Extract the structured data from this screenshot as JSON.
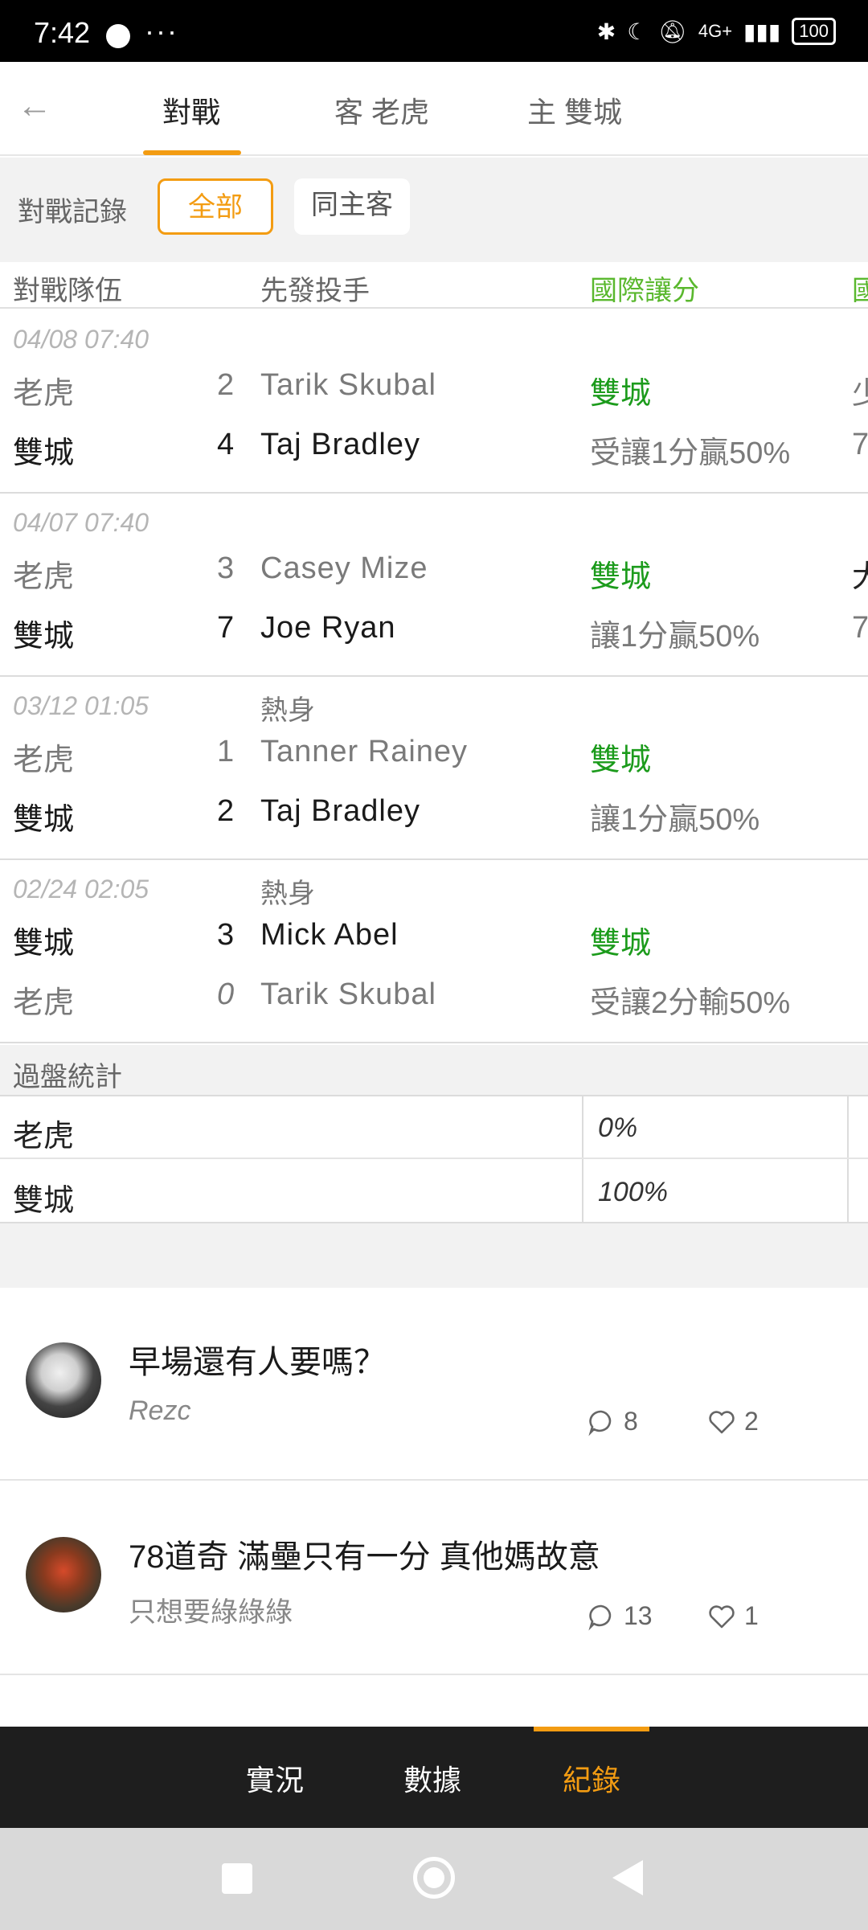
{
  "status_bar": {
    "time": "7:42",
    "more": "···",
    "network": "4G+",
    "battery": "100"
  },
  "nav": {
    "tabs": [
      {
        "label": "對戰"
      },
      {
        "label": "客 老虎"
      },
      {
        "label": "主 雙城"
      }
    ],
    "active_tab": 0
  },
  "filter": {
    "label": "對戰記錄",
    "chips": [
      {
        "label": "全部"
      },
      {
        "label": "同主客"
      }
    ],
    "selected": "全部"
  },
  "table_header": {
    "team": "對戰隊伍",
    "pitcher": "先發投手",
    "handicap": "國際讓分",
    "extra": "國"
  },
  "matches": [
    {
      "date": "04/08 07:40",
      "tag": "",
      "rows": [
        {
          "team": "老虎",
          "score": "2",
          "pitcher": "Tarik Skubal",
          "odds": "雙城",
          "extra": "少"
        },
        {
          "team": "雙城",
          "score": "4",
          "pitcher": "Taj Bradley",
          "odds": "受讓1分贏50%",
          "extra": "7"
        }
      ]
    },
    {
      "date": "04/07 07:40",
      "tag": "",
      "rows": [
        {
          "team": "老虎",
          "score": "3",
          "pitcher": "Casey Mize",
          "odds": "雙城",
          "extra": "大"
        },
        {
          "team": "雙城",
          "score": "7",
          "pitcher": "Joe Ryan",
          "odds": "讓1分贏50%",
          "extra": "7"
        }
      ]
    },
    {
      "date": "03/12 01:05",
      "tag": "熱身",
      "rows": [
        {
          "team": "老虎",
          "score": "1",
          "pitcher": "Tanner Rainey",
          "odds": "雙城",
          "extra": ""
        },
        {
          "team": "雙城",
          "score": "2",
          "pitcher": "Taj Bradley",
          "odds": "讓1分贏50%",
          "extra": ""
        }
      ]
    },
    {
      "date": "02/24 02:05",
      "tag": "熱身",
      "rows": [
        {
          "team": "雙城",
          "score": "3",
          "pitcher": "Mick Abel",
          "odds": "雙城",
          "extra": ""
        },
        {
          "team": "老虎",
          "score": "0",
          "pitcher": "Tarik Skubal",
          "odds": "受讓2分輸50%",
          "extra": ""
        }
      ]
    }
  ],
  "stats": {
    "title": "過盤統計",
    "rows": [
      {
        "team": "老虎",
        "pct": "0%"
      },
      {
        "team": "雙城",
        "pct": "100%"
      }
    ]
  },
  "posts": [
    {
      "title": "早場還有人要嗎？",
      "author": "Rezc",
      "comments": "8",
      "likes": "2"
    },
    {
      "title": "78道奇 滿壘只有一分 真他媽故意",
      "author": "只想要綠綠綠",
      "comments": "13",
      "likes": "1"
    }
  ],
  "bottom_tabs": [
    {
      "label": "實況"
    },
    {
      "label": "數據"
    },
    {
      "label": "紀錄"
    }
  ],
  "colors": {
    "accent": "#f39c12",
    "winner_green": "#1c9b1c",
    "header_green": "#5ab82e"
  }
}
